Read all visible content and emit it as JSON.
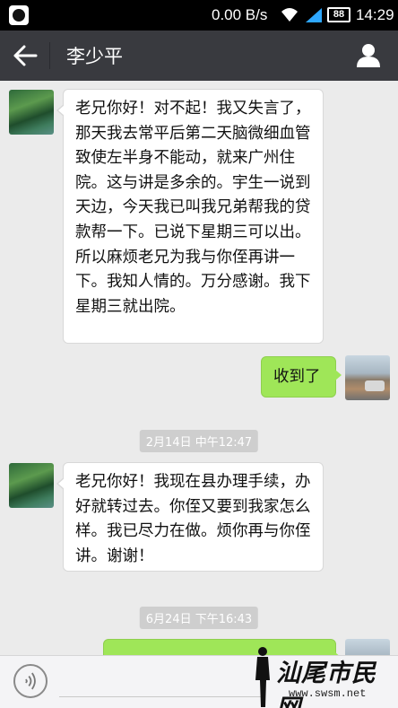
{
  "status_bar": {
    "net_speed": "0.00 B/s",
    "battery": "88",
    "time": "14:29"
  },
  "header": {
    "contact_name": "李少平",
    "colors": {
      "bar": "#393a3f",
      "text": "#ffffff"
    }
  },
  "messages": [
    {
      "side": "left",
      "text": "老兄你好！对不起！我又失言了，那天我去常平后第二天脑微细血管致使左半身不能动，就来广州住院。这与讲是多余的。宇生一说到天边，今天我已叫我兄弟帮我的贷款帮一下。已说下星期三可以出。所以麻烦老兄为我与你侄再讲一下。我知人情的。万分感谢。我下星期三就出院。"
    },
    {
      "side": "right",
      "text": "收到了"
    },
    {
      "type": "timestamp",
      "text": "2月14日 中午12:47"
    },
    {
      "side": "left",
      "text": "老兄你好！我现在县办理手续，办好就转过去。你侄又要到我家怎么样。我已尽力在做。烦你再与你侄讲。谢谢！"
    },
    {
      "type": "timestamp",
      "text": "6月24日 下午16:43"
    }
  ],
  "chat_colors": {
    "background": "#ebebeb",
    "incoming_bubble": "#ffffff",
    "outgoing_bubble": "#9fe658"
  },
  "input_bar": {
    "voice_icon": "voice-icon"
  },
  "watermark": {
    "title": "汕尾市民网",
    "url": "www.swsm.net"
  }
}
